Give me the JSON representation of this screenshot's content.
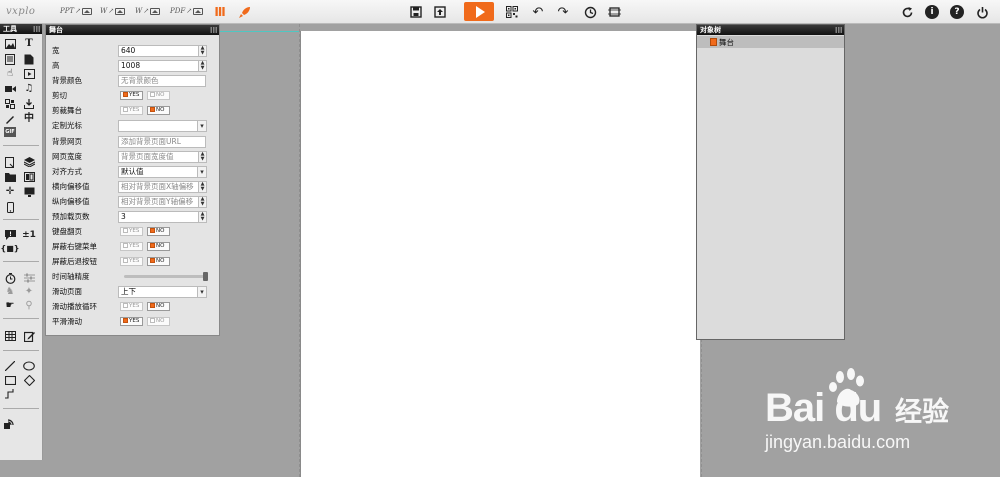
{
  "topbar": {
    "logo": "vxplo",
    "imports": [
      {
        "label": "PPT",
        "icon": "ppt-import-icon"
      },
      {
        "label": "W",
        "icon": "word-import-icon"
      },
      {
        "label": "W",
        "icon": "word-doc-import-icon"
      },
      {
        "label": "PDF",
        "icon": "pdf-import-icon"
      }
    ],
    "icons": [
      "library-icon",
      "rocket-icon",
      "save-icon",
      "publish-icon",
      "play-icon",
      "qrcode-icon",
      "undo-icon",
      "redo-icon",
      "history-icon",
      "screenshot-icon",
      "refresh-icon",
      "info-icon",
      "help-icon",
      "power-icon"
    ],
    "accent_color": "#f06a1b"
  },
  "tools_panel": {
    "title": "工具",
    "text_tool_glyph": "T",
    "counter_label": "±1",
    "chinese_tool_label": "中",
    "gif_label": "GIF"
  },
  "stage_panel": {
    "title": "舞台",
    "width": {
      "label": "宽",
      "value": "640"
    },
    "height": {
      "label": "高",
      "value": "1008"
    },
    "bg_color": {
      "label": "背景颜色",
      "placeholder": "无背景颜色"
    },
    "clip": {
      "label": "剪切",
      "selected": "YES"
    },
    "clip_stage": {
      "label": "剪裁舞台",
      "selected": "NO"
    },
    "cursor": {
      "label": "定制光标",
      "value": ""
    },
    "bg_page": {
      "label": "背景网页",
      "placeholder": "添加背景页面URL"
    },
    "page_width": {
      "label": "网页宽度",
      "placeholder": "背景页面宽度值"
    },
    "align": {
      "label": "对齐方式",
      "value": "默认值"
    },
    "offset_x": {
      "label": "横向偏移值",
      "placeholder": "相对背景页面X轴偏移"
    },
    "offset_y": {
      "label": "纵向偏移值",
      "placeholder": "相对背景页面Y轴偏移"
    },
    "preload": {
      "label": "预加载页数",
      "value": "3"
    },
    "keyboard_flip": {
      "label": "键盘翻页",
      "selected": "NO"
    },
    "hide_context_menu": {
      "label": "屏蔽右键菜单",
      "selected": "NO"
    },
    "hide_back_button": {
      "label": "屏蔽后退按钮",
      "selected": "NO"
    },
    "timeline_precision": {
      "label": "时间轴精度",
      "level": 1.0
    },
    "scroll_page": {
      "label": "滑动页面",
      "value": "上下"
    },
    "scroll_loop": {
      "label": "滑动播放循环",
      "selected": "NO"
    },
    "smooth_scroll": {
      "label": "平滑滑动",
      "selected": "YES"
    },
    "yes_label": "YES",
    "no_label": "NO"
  },
  "object_tree": {
    "title": "对象树",
    "items": [
      {
        "label": "舞台"
      }
    ]
  },
  "watermark": {
    "brand": "Bai du",
    "cn": "经验",
    "url": "jingyan.baidu.com"
  }
}
